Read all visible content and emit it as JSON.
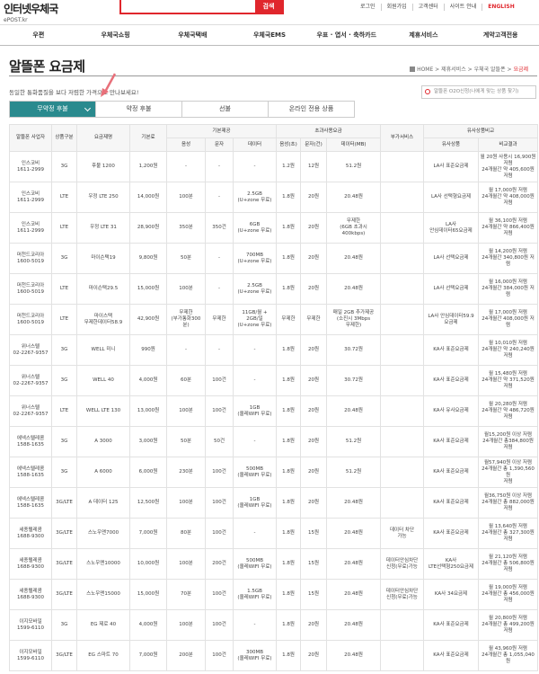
{
  "header": {
    "logo_main": "인터넷우체국",
    "logo_sub": "ePOST.kr",
    "search_placeholder": "",
    "search_button": "검색",
    "util": [
      "로그인",
      "회원가입",
      "고객센터",
      "사이트 안내",
      "ENGLISH"
    ]
  },
  "nav": [
    "우편",
    "우체국쇼핑",
    "우체국택배",
    "우체국EMS",
    "우표 · 엽서 · 축하카드",
    "제휴서비스",
    "계약고객전용"
  ],
  "page": {
    "title": "알뜰폰 요금제",
    "breadcrumb": [
      "HOME",
      "제휴서비스",
      "우체국 알뜰폰",
      "요금제"
    ],
    "description": "동일한 통화품질을 보다 저렴한 가격으로 만나보세요!",
    "o2o_placeholder": "알뜰폰 O2O신청(나에게 맞는 상품 찾기)"
  },
  "tabs": [
    "무약정 후불",
    "약정 후불",
    "선불",
    "온라인 전용 상품"
  ],
  "table": {
    "group_headers": {
      "basic": "기본제공",
      "excess": "초과사용요금",
      "compare": "유사상품비교"
    },
    "headers": [
      "알뜰폰 사업자",
      "상품구분",
      "요금제명",
      "기본료",
      "음성",
      "문자",
      "데이터",
      "음성(초)",
      "문자(건)",
      "데이터(MB)",
      "부가서비스",
      "유사상품",
      "비교결과"
    ],
    "rows": [
      [
        "인스코비\n1611-2999",
        "3G",
        "후불 1200",
        "1,200원",
        "-",
        "-",
        "-",
        "1.2원",
        "12원",
        "51.2원",
        "",
        "LA사 표준요금제",
        "월 20원 사용시 16,900원\n저렴\n24개월간 약 405,600원\n저렴"
      ],
      [
        "인스코비\n1611-2999",
        "LTE",
        "우정 LTE 250",
        "14,000원",
        "100분",
        "-",
        "2.5GB\n(U+zone 무료)",
        "1.8원",
        "20원",
        "20.48원",
        "",
        "LA사 선택형요금제",
        "월 17,000원 저렴\n24개월간 약 408,000원\n저렴"
      ],
      [
        "인스코비\n1611-2999",
        "LTE",
        "우정 LTE 31",
        "28,900원",
        "350분",
        "350건",
        "6GB\n(U+zone 무료)",
        "1.8원",
        "20원",
        "무제한\n(6GB 초과시\n400kbps)",
        "",
        "LA사\n안심데이터65요금제",
        "월 36,100원 저렴\n24개월간 약 866,400원\n저렴"
      ],
      [
        "머천드코리아\n1600-5019",
        "3G",
        "마이슨택19",
        "9,800원",
        "50분",
        "-",
        "700MB\n(U+zone 무료)",
        "1.8원",
        "20원",
        "20.48원",
        "",
        "LA사 선택요금제",
        "월 14,200원 저렴\n24개월간 340,800원 저렴"
      ],
      [
        "머천드코리아\n1600-5019",
        "LTE",
        "마이슨택29.5",
        "15,000원",
        "100분",
        "-",
        "2.5GB\n(U+zone 무료)",
        "1.8원",
        "20원",
        "20.48원",
        "",
        "LA사 선택요금제",
        "월 16,000원 저렴\n24개월간 384,000원 저렴"
      ],
      [
        "머천드코리아\n1600-5019",
        "LTE",
        "마이스택\n무제한데이터58.9",
        "42,900원",
        "무제한\n(부가통화300분)",
        "무제한",
        "11GB/월 +\n2GB/일\n(U+zone 무료)",
        "무제한",
        "무제한",
        "매일 2GB 추가제공\n(소진시 3Mbps\n무제한)",
        "",
        "LA사 안심데이터59.9\n요금제",
        "월 17,000원 저렴\n24개월간 408,000원 저렴"
      ],
      [
        "위너스텔\n02-2267-9357",
        "3G",
        "WELL 미니",
        "990원",
        "-",
        "-",
        "-",
        "1.8원",
        "20원",
        "30.72원",
        "",
        "KA사 표준요금제",
        "월 10,010원 저렴\n24개월간 약 240,240원\n저렴"
      ],
      [
        "위너스텔\n02-2267-9357",
        "3G",
        "WELL 40",
        "4,000원",
        "60분",
        "100건",
        "-",
        "1.8원",
        "20원",
        "30.72원",
        "",
        "KA사 표준요금제",
        "월 15,480원 저렴\n24개월간 약 371,520원\n저렴"
      ],
      [
        "위너스텔\n02-2267-9357",
        "LTE",
        "WELL LTE 130",
        "13,000원",
        "100분",
        "100건",
        "1GB\n(올레WIFI 무료)",
        "1.8원",
        "20원",
        "20.48원",
        "",
        "KA사 유사요금제",
        "월 20,280원 저렴\n24개월간 약 486,720원\n저렴"
      ],
      [
        "에넥스텔레콤\n1588-1635",
        "3G",
        "A 3000",
        "3,000원",
        "50분",
        "50건",
        "-",
        "1.8원",
        "20원",
        "51.2원",
        "",
        "KA사 표준요금제",
        "월15,200원 이상 저렴\n24개월간 총384,800원\n저렴"
      ],
      [
        "에넥스텔레콤\n1588-1635",
        "3G",
        "A 6000",
        "6,000원",
        "230분",
        "100건",
        "500MB\n(올레WIFI 무료)",
        "1.8원",
        "20원",
        "51.2원",
        "",
        "KA사 표준요금제",
        "월57,940원 이상 저렴\n24개월간 총 1,390,560원\n저렴"
      ],
      [
        "에넥스텔레콤\n1588-1635",
        "3G/LTE",
        "A 데이터 125",
        "12,500원",
        "100분",
        "100건",
        "1GB\n(올레WIFI 무료)",
        "1.8원",
        "20원",
        "20.48원",
        "",
        "KA사 표준요금제",
        "월36,750원 이상 저렴\n24개월간 총 882,000원\n저렴"
      ],
      [
        "세종텔레콤\n1688-9300",
        "3G/LTE",
        "스노우맨7000",
        "7,000원",
        "80분",
        "100건",
        "-",
        "1.8원",
        "15원",
        "20.48원",
        "데이터 차단\n가능",
        "KA사 표준요금제",
        "월 13,640원 저렴\n24개월간 총 327,300원\n저렴"
      ],
      [
        "세종텔레콤\n1688-9300",
        "3G/LTE",
        "스노우맨10000",
        "10,000원",
        "100분",
        "200건",
        "500MB\n(올레WIFI 무료)",
        "1.8원",
        "15원",
        "20.48원",
        "데이터안심차단\n신청(무료)가능",
        "KA사\nLTE선택형250요금제",
        "월 21,120원 저렴\n24개월간 총 506,800원\n저렴"
      ],
      [
        "세종텔레콤\n1688-9300",
        "3G/LTE",
        "스노우맨15000",
        "15,000원",
        "70분",
        "100건",
        "1.5GB\n(올레WIFI 무료)",
        "1.8원",
        "15원",
        "20.48원",
        "데이터안심차단\n신청(무료)가능",
        "KA사 34요금제",
        "월 19,000원 저렴\n24개월간 총 456,000원\n저렴"
      ],
      [
        "이지모바일\n1599-6110",
        "3G",
        "EG 제로 40",
        "4,000원",
        "100분",
        "100건",
        "-",
        "1.8원",
        "20원",
        "20.48원",
        "",
        "KA사 표준요금제",
        "월 20,800원 저렴\n24개월간 총 499,200원\n저렴"
      ],
      [
        "이지모바일\n1599-6110",
        "3G/LTE",
        "EG 스마트 70",
        "7,000원",
        "200분",
        "100건",
        "300MB\n(올레WIFI 무료)",
        "1.8원",
        "20원",
        "20.48원",
        "",
        "KA사 표준요금제",
        "월 43,960원 저렴\n24개월간 총 1,055,040원"
      ]
    ]
  }
}
